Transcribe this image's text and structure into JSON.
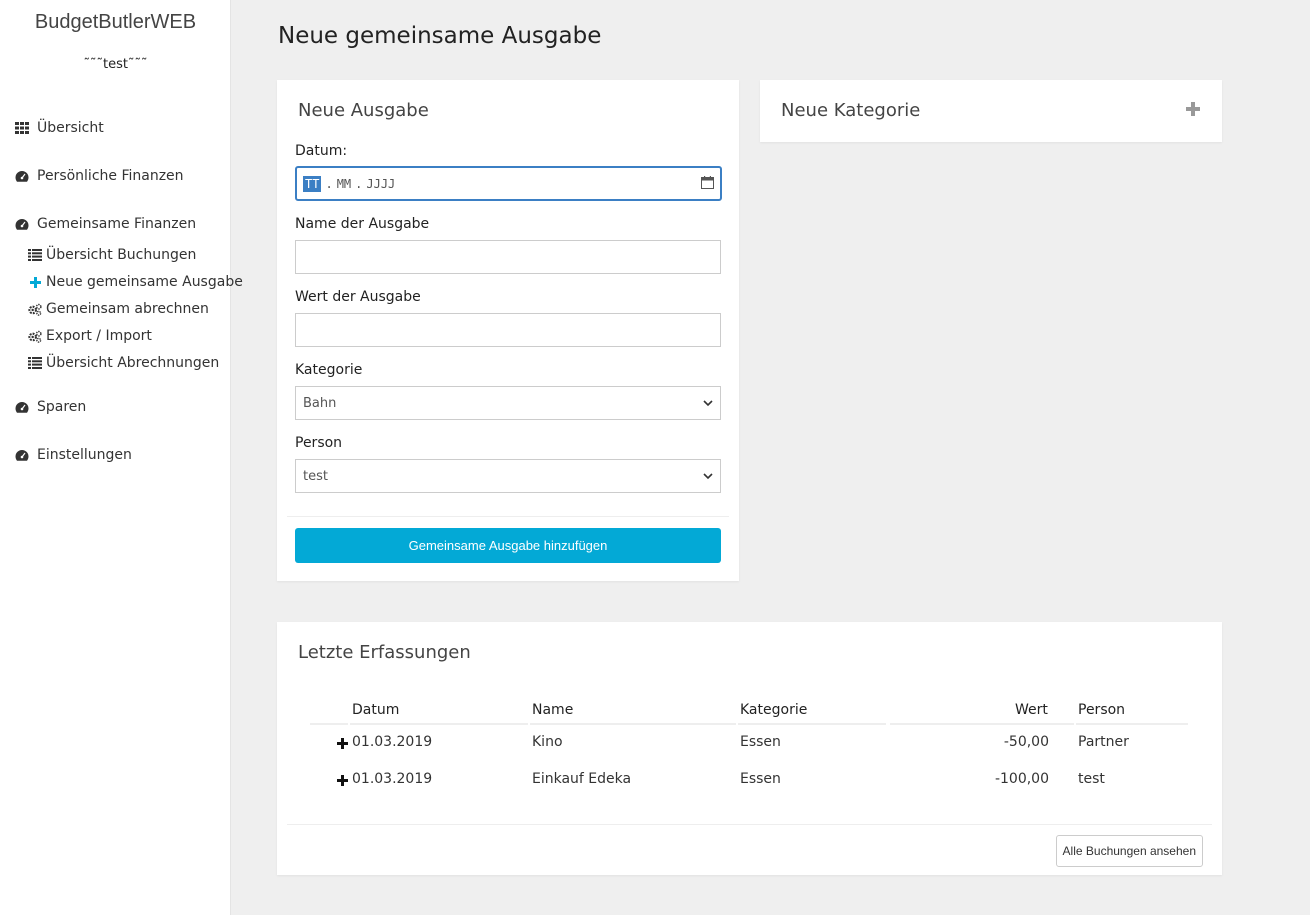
{
  "app": {
    "brand": "BudgetButlerWEB",
    "user": "˜˜˜test˜˜˜"
  },
  "sidebar": {
    "items": [
      {
        "label": "Übersicht",
        "icon": "grid-icon"
      },
      {
        "label": "Persönliche Finanzen",
        "icon": "dashboard-icon"
      },
      {
        "label": "Gemeinsame Finanzen",
        "icon": "dashboard-icon"
      },
      {
        "label": "Sparen",
        "icon": "dashboard-icon"
      },
      {
        "label": "Einstellungen",
        "icon": "dashboard-icon"
      }
    ],
    "subitems": [
      {
        "label": "Übersicht Buchungen",
        "icon": "list-icon"
      },
      {
        "label": "Neue gemeinsame Ausgabe",
        "icon": "plus-icon"
      },
      {
        "label": "Gemeinsam abrechnen",
        "icon": "gears-icon"
      },
      {
        "label": "Export / Import",
        "icon": "gears-icon"
      },
      {
        "label": "Übersicht Abrechnungen",
        "icon": "list-icon"
      }
    ]
  },
  "page": {
    "title": "Neue gemeinsame Ausgabe"
  },
  "form": {
    "title": "Neue Ausgabe",
    "date_label": "Datum:",
    "date_placeholder": {
      "day": "TT",
      "month": "MM",
      "year": "JJJJ",
      "sep": "."
    },
    "name_label": "Name der Ausgabe",
    "name_value": "",
    "value_label": "Wert der Ausgabe",
    "value_value": "",
    "category_label": "Kategorie",
    "category_selected": "Bahn",
    "person_label": "Person",
    "person_selected": "test",
    "submit_label": "Gemeinsame Ausgabe hinzufügen"
  },
  "new_category": {
    "title": "Neue Kategorie"
  },
  "recent": {
    "title": "Letzte Erfassungen",
    "columns": {
      "date": "Datum",
      "name": "Name",
      "category": "Kategorie",
      "value": "Wert",
      "person": "Person"
    },
    "rows": [
      {
        "date": "01.03.2019",
        "name": "Kino",
        "category": "Essen",
        "value": "-50,00",
        "person": "Partner"
      },
      {
        "date": "01.03.2019",
        "name": "Einkauf Edeka",
        "category": "Essen",
        "value": "-100,00",
        "person": "test"
      }
    ],
    "all_button": "Alle Buchungen ansehen"
  },
  "colors": {
    "accent": "#03a9d6",
    "focus": "#3b7fc4",
    "background": "#efefef"
  }
}
